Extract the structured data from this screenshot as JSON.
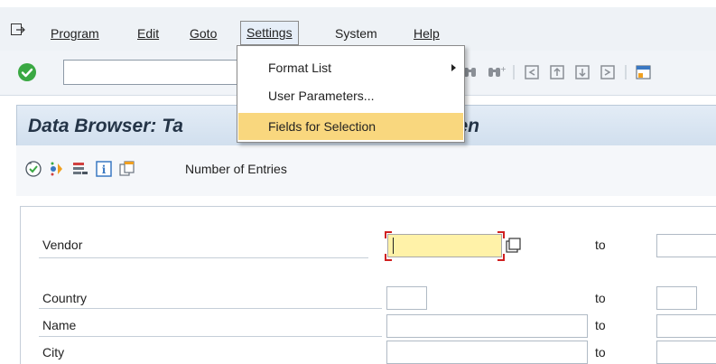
{
  "menubar": {
    "items": [
      {
        "label": "Program"
      },
      {
        "label": "Edit"
      },
      {
        "label": "Goto"
      },
      {
        "label": "Settings"
      },
      {
        "label": "System"
      },
      {
        "label": "Help"
      }
    ],
    "active_item": "Settings"
  },
  "settings_menu": {
    "items": [
      {
        "label": "Format List",
        "has_submenu": true
      },
      {
        "label": "User Parameters..."
      },
      {
        "label": "Fields for Selection",
        "highlighted": true
      }
    ]
  },
  "toolbar": {
    "command_field_value": "",
    "icons": [
      "find-icon",
      "find-next-icon",
      "first-page-icon",
      "previous-page-icon",
      "next-page-icon",
      "last-page-icon",
      "create-session-icon"
    ]
  },
  "title": {
    "left_text": "Data Browser: Ta",
    "right_text": "Screen"
  },
  "app_toolbar": {
    "icons": [
      "execute-icon",
      "selection-options-icon",
      "delete-selection-icon",
      "info-icon",
      "copy-icon"
    ],
    "number_of_entries_label": "Number of Entries"
  },
  "selection_fields": [
    {
      "label": "Vendor",
      "value": "",
      "to_label": "to",
      "to_value": ""
    },
    {
      "label": "Country",
      "value": "",
      "to_label": "to",
      "to_value": ""
    },
    {
      "label": "Name",
      "value": "",
      "to_label": "to",
      "to_value": ""
    },
    {
      "label": "City",
      "value": "",
      "to_label": "to",
      "to_value": ""
    }
  ],
  "colors": {
    "menu_highlight": "#f9d77e",
    "focused_input": "#fff2a8",
    "title_text": "#243447",
    "ok_green": "#3aa843"
  }
}
